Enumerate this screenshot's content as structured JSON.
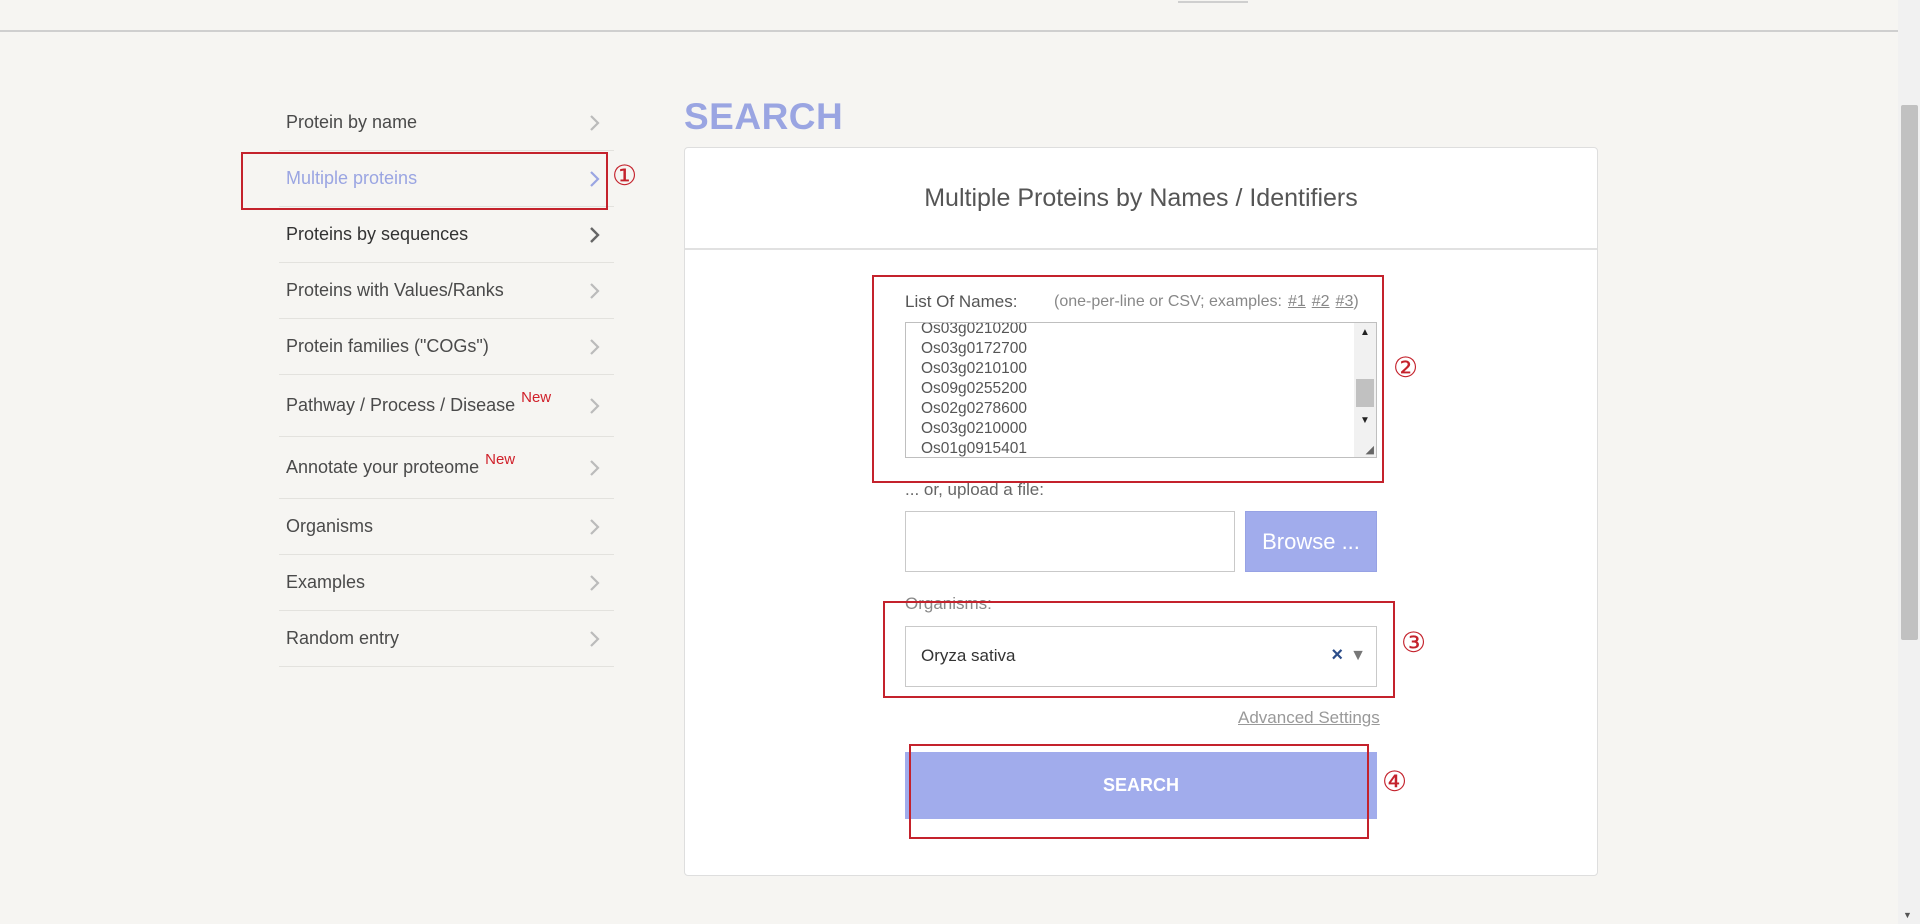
{
  "sidebar": {
    "items": [
      {
        "label": "Protein by name"
      },
      {
        "label": "Multiple proteins"
      },
      {
        "label": "Proteins by sequences"
      },
      {
        "label": "Proteins with Values/Ranks"
      },
      {
        "label": "Protein families (\"COGs\")"
      },
      {
        "label": "Pathway / Process / Disease",
        "badge": "New"
      },
      {
        "label": "Annotate your proteome",
        "badge": "New"
      },
      {
        "label": "Organisms"
      },
      {
        "label": "Examples"
      },
      {
        "label": "Random entry"
      }
    ]
  },
  "main": {
    "heading": "SEARCH",
    "panel_title": "Multiple Proteins by Names / Identifiers",
    "names_label": "List Of Names:",
    "names_hint": "(one-per-line or CSV; examples:",
    "examples": [
      "#1",
      "#2",
      "#3"
    ],
    "hint_close": ")",
    "names_lines": [
      "Os03g0210200",
      "Os03g0172700",
      "Os03g0210100",
      "Os09g0255200",
      "Os02g0278600",
      "Os03g0210000",
      "Os01g0915401"
    ],
    "upload_label": "... or, upload a file:",
    "browse_label": "Browse ...",
    "organisms_label": "Organisms:",
    "organism_value": "Oryza sativa",
    "clear_symbol": "×",
    "caret_symbol": "▼",
    "advanced_label": "Advanced Settings",
    "search_label": "SEARCH"
  },
  "annotations": [
    "①",
    "②",
    "③",
    "④"
  ],
  "colors": {
    "accent": "#a1acec",
    "annotation": "#c4222c",
    "badge": "#d0202a"
  }
}
